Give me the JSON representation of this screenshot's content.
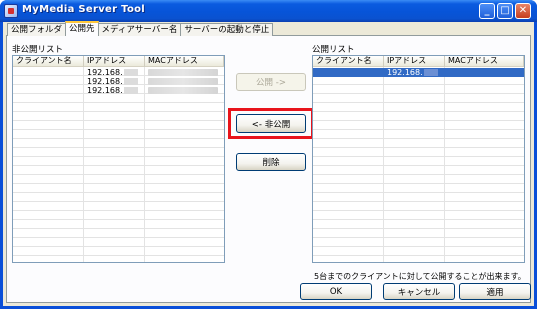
{
  "window": {
    "title": "MyMedia Server Tool",
    "minimize_glyph": "_",
    "maximize_glyph": "□",
    "close_glyph": "✕"
  },
  "tabs": [
    {
      "label": "公開フォルダ",
      "active": false
    },
    {
      "label": "公開先",
      "active": true
    },
    {
      "label": "メディアサーバー名",
      "active": false
    },
    {
      "label": "サーバーの起動と停止",
      "active": false
    }
  ],
  "private_list": {
    "label": "非公開リスト",
    "columns": [
      "クライアント名",
      "IPアドレス",
      "MACアドレス"
    ],
    "rows": [
      {
        "client": "",
        "ip": "192.168.",
        "mac": ""
      },
      {
        "client": "",
        "ip": "192.168.",
        "mac": ""
      },
      {
        "client": "",
        "ip": "192.168.",
        "mac": ""
      }
    ]
  },
  "public_list": {
    "label": "公開リスト",
    "columns": [
      "クライアント名",
      "IPアドレス",
      "MACアドレス"
    ],
    "rows": [
      {
        "client": "",
        "ip": "192.168.",
        "mac": "",
        "selected": true
      }
    ]
  },
  "buttons": {
    "publish": "公開 ->",
    "unpublish": "<- 非公開",
    "delete": "削除",
    "ok": "OK",
    "cancel": "キャンセル",
    "apply": "適用"
  },
  "note": "5台までのクライアントに対して公開することが出来ます。",
  "colors": {
    "highlight": "#e8141c",
    "selection": "#316ac5",
    "titlebar": "#0754d8"
  }
}
